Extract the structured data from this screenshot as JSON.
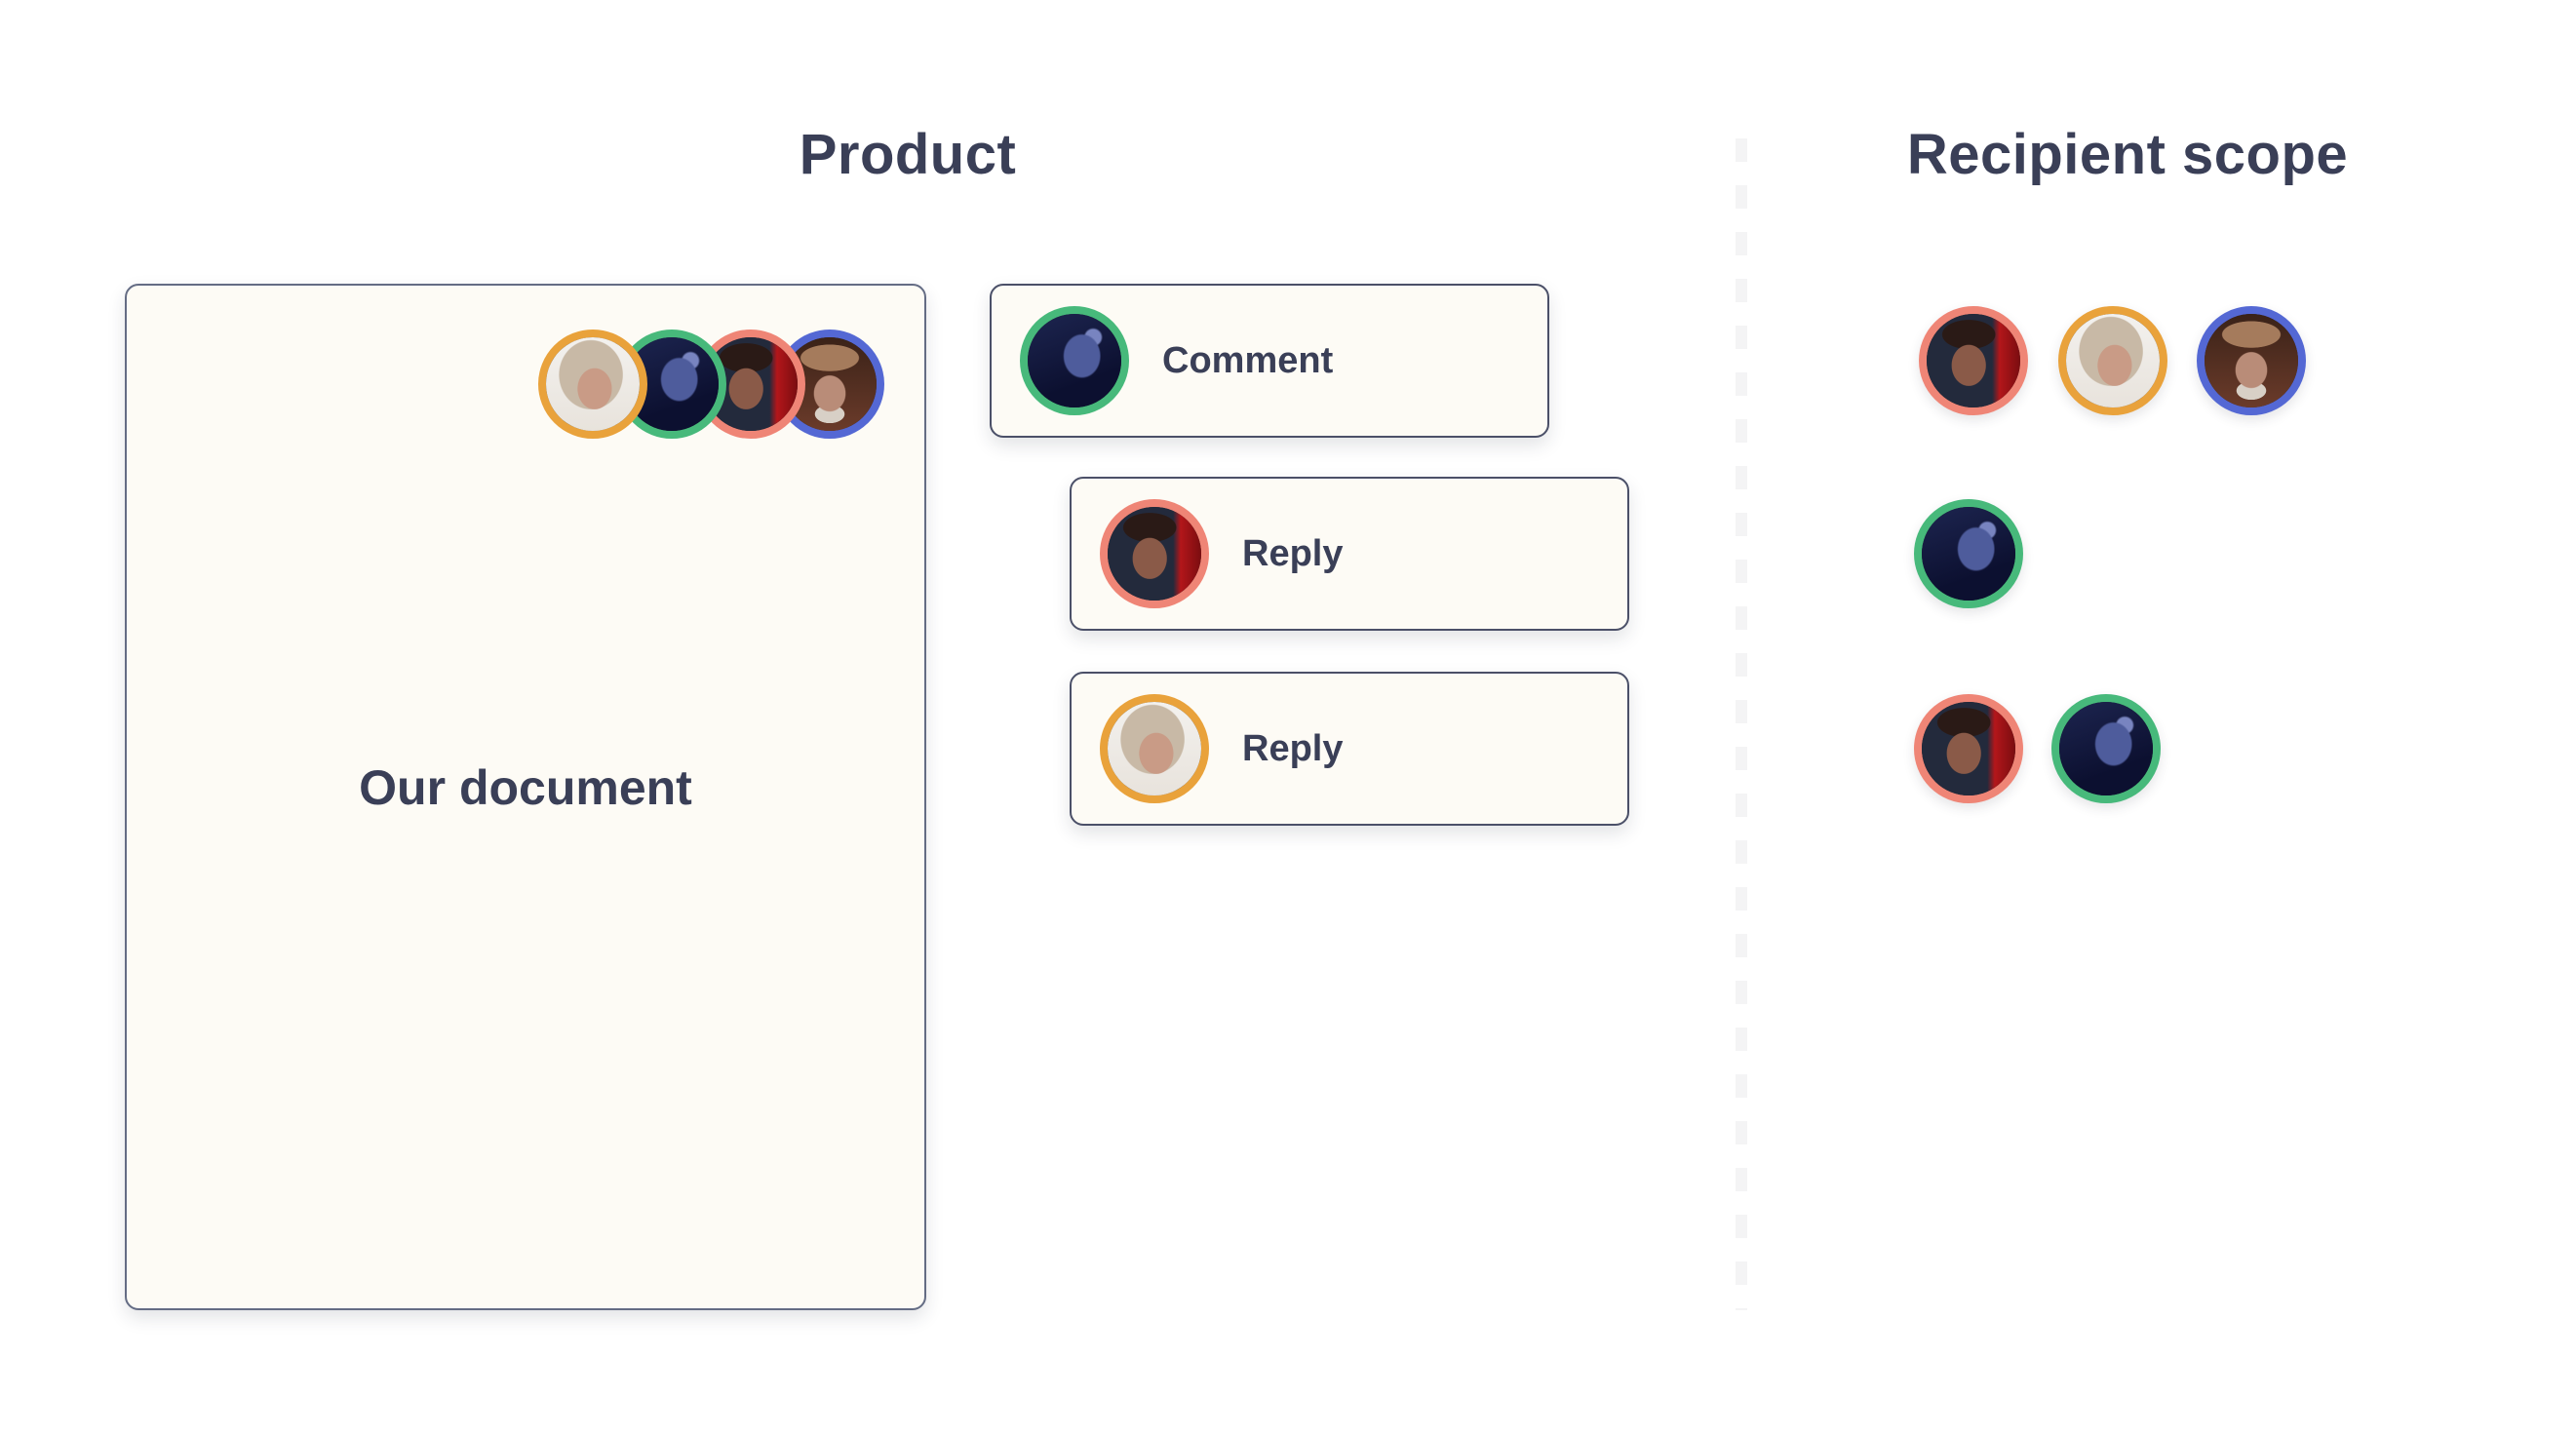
{
  "product": {
    "title": "Product",
    "document": {
      "label": "Our document",
      "participants": [
        {
          "ring": "orange",
          "ring_color": "#e9a23b"
        },
        {
          "ring": "green",
          "ring_color": "#47b97b"
        },
        {
          "ring": "salmon",
          "ring_color": "#ef8576"
        },
        {
          "ring": "blue",
          "ring_color": "#5468d4"
        }
      ]
    },
    "thread": [
      {
        "type": "comment",
        "label": "Comment",
        "author_ring": "green"
      },
      {
        "type": "reply",
        "label": "Reply",
        "author_ring": "salmon"
      },
      {
        "type": "reply",
        "label": "Reply",
        "author_ring": "orange"
      }
    ]
  },
  "recipient_scope": {
    "title": "Recipient scope",
    "rows": [
      {
        "for": "Comment",
        "recipients": [
          "salmon",
          "orange",
          "blue"
        ]
      },
      {
        "for": "Reply",
        "recipients": [
          "green"
        ]
      },
      {
        "for": "Reply",
        "recipients": [
          "salmon",
          "green"
        ]
      }
    ]
  },
  "colors": {
    "text": "#3a3f57",
    "card_bg": "#fdfbf5",
    "card_border": "#4b5068",
    "divider": "#f4f4f5",
    "orange": "#e9a23b",
    "green": "#47b97b",
    "salmon": "#ef8576",
    "blue": "#5468d4"
  }
}
